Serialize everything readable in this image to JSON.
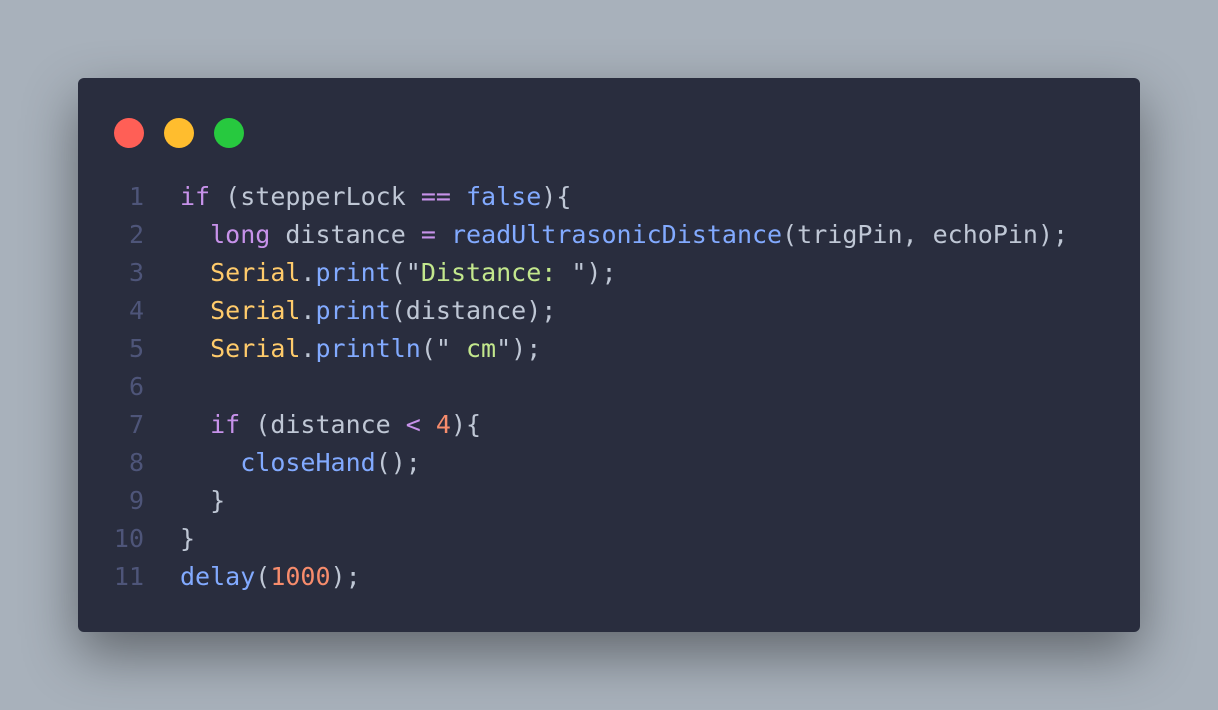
{
  "window": {
    "controls": [
      {
        "name": "close-light",
        "color": "#ff5f56"
      },
      {
        "name": "minimize-light",
        "color": "#ffbd2e"
      },
      {
        "name": "maximize-light",
        "color": "#27c93f"
      }
    ]
  },
  "colors": {
    "background": "#a8b1bb",
    "editor_background": "#292d3e",
    "line_number": "#4e5579",
    "keyword": "#c792ea",
    "plain": "#bfc7d5",
    "function": "#82aaff",
    "class": "#ffcb6b",
    "string": "#c3e88d",
    "number": "#f78c6c",
    "operator": "#89ddff"
  },
  "code": {
    "lines": [
      {
        "number": "1",
        "tokens": [
          {
            "text": "if",
            "type": "keyword"
          },
          {
            "text": " (stepperLock ",
            "type": "plain"
          },
          {
            "text": "==",
            "type": "keyword"
          },
          {
            "text": " ",
            "type": "plain"
          },
          {
            "text": "false",
            "type": "function"
          },
          {
            "text": "){",
            "type": "plain"
          }
        ]
      },
      {
        "number": "2",
        "tokens": [
          {
            "text": "  ",
            "type": "plain"
          },
          {
            "text": "long",
            "type": "keyword"
          },
          {
            "text": " distance ",
            "type": "plain"
          },
          {
            "text": "=",
            "type": "keyword"
          },
          {
            "text": " ",
            "type": "plain"
          },
          {
            "text": "readUltrasonicDistance",
            "type": "function"
          },
          {
            "text": "(trigPin, echoPin);",
            "type": "plain"
          }
        ]
      },
      {
        "number": "3",
        "tokens": [
          {
            "text": "  ",
            "type": "plain"
          },
          {
            "text": "Serial",
            "type": "class"
          },
          {
            "text": ".",
            "type": "plain"
          },
          {
            "text": "print",
            "type": "function"
          },
          {
            "text": "(\"",
            "type": "plain"
          },
          {
            "text": "Distance: ",
            "type": "string"
          },
          {
            "text": "\");",
            "type": "plain"
          }
        ]
      },
      {
        "number": "4",
        "tokens": [
          {
            "text": "  ",
            "type": "plain"
          },
          {
            "text": "Serial",
            "type": "class"
          },
          {
            "text": ".",
            "type": "plain"
          },
          {
            "text": "print",
            "type": "function"
          },
          {
            "text": "(distance);",
            "type": "plain"
          }
        ]
      },
      {
        "number": "5",
        "tokens": [
          {
            "text": "  ",
            "type": "plain"
          },
          {
            "text": "Serial",
            "type": "class"
          },
          {
            "text": ".",
            "type": "plain"
          },
          {
            "text": "println",
            "type": "function"
          },
          {
            "text": "(\"",
            "type": "plain"
          },
          {
            "text": " cm",
            "type": "string"
          },
          {
            "text": "\");",
            "type": "plain"
          }
        ]
      },
      {
        "number": "6",
        "tokens": []
      },
      {
        "number": "7",
        "tokens": [
          {
            "text": "  ",
            "type": "plain"
          },
          {
            "text": "if",
            "type": "keyword"
          },
          {
            "text": " (distance ",
            "type": "plain"
          },
          {
            "text": "<",
            "type": "keyword"
          },
          {
            "text": " ",
            "type": "plain"
          },
          {
            "text": "4",
            "type": "number"
          },
          {
            "text": "){",
            "type": "plain"
          }
        ]
      },
      {
        "number": "8",
        "tokens": [
          {
            "text": "    ",
            "type": "plain"
          },
          {
            "text": "closeHand",
            "type": "function"
          },
          {
            "text": "();",
            "type": "plain"
          }
        ]
      },
      {
        "number": "9",
        "tokens": [
          {
            "text": "  }",
            "type": "plain"
          }
        ]
      },
      {
        "number": "10",
        "tokens": [
          {
            "text": "}",
            "type": "plain"
          }
        ]
      },
      {
        "number": "11",
        "tokens": [
          {
            "text": "delay",
            "type": "function"
          },
          {
            "text": "(",
            "type": "plain"
          },
          {
            "text": "1000",
            "type": "number"
          },
          {
            "text": ");",
            "type": "plain"
          }
        ]
      }
    ]
  }
}
